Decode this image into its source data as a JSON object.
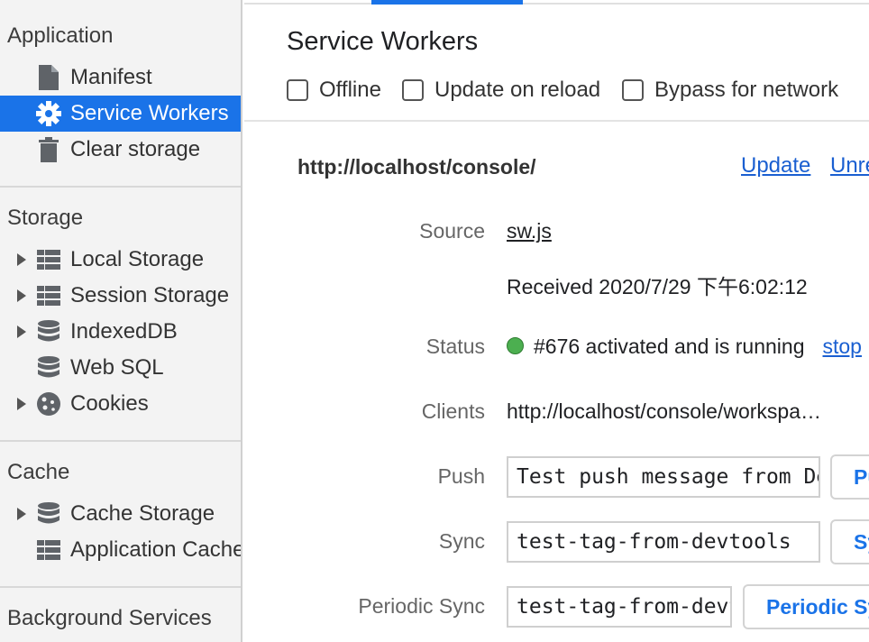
{
  "sidebar": {
    "sections": [
      {
        "title": "Application",
        "items": [
          {
            "label": "Manifest",
            "icon": "file-icon"
          },
          {
            "label": "Service Workers",
            "icon": "gear-icon",
            "selected": true
          },
          {
            "label": "Clear storage",
            "icon": "trash-icon"
          }
        ]
      },
      {
        "title": "Storage",
        "items": [
          {
            "label": "Local Storage",
            "icon": "grid-icon",
            "expandable": true
          },
          {
            "label": "Session Storage",
            "icon": "grid-icon",
            "expandable": true
          },
          {
            "label": "IndexedDB",
            "icon": "database-icon",
            "expandable": true
          },
          {
            "label": "Web SQL",
            "icon": "database-icon"
          },
          {
            "label": "Cookies",
            "icon": "cookie-icon",
            "expandable": true
          }
        ]
      },
      {
        "title": "Cache",
        "items": [
          {
            "label": "Cache Storage",
            "icon": "database-icon",
            "expandable": true
          },
          {
            "label": "Application Cache",
            "icon": "grid-icon"
          }
        ]
      },
      {
        "title": "Background Services",
        "items": []
      }
    ]
  },
  "main": {
    "title": "Service Workers",
    "options": [
      {
        "label": "Offline",
        "checked": false
      },
      {
        "label": "Update on reload",
        "checked": false
      },
      {
        "label": "Bypass for network",
        "checked": false
      }
    ],
    "scope": "http://localhost/console/",
    "update_link": "Update",
    "unregister_link": "Unregister",
    "rows": {
      "source_label": "Source",
      "source_value": "sw.js",
      "received": "Received 2020/7/29 下午6:02:12",
      "status_label": "Status",
      "status_value": "#676 activated and is running",
      "stop_link": "stop",
      "clients_label": "Clients",
      "clients_value": "http://localhost/console/workspa…",
      "push_label": "Push",
      "push_value": "Test push message from DevTools.",
      "push_button": "Push",
      "sync_label": "Sync",
      "sync_value": "test-tag-from-devtools",
      "sync_button": "Sync",
      "periodic_label": "Periodic Sync",
      "periodic_value": "test-tag-from-devtools",
      "periodic_button": "Periodic Sync"
    },
    "colors": {
      "accent": "#1a73e8",
      "status_running": "#4caf50",
      "link": "#1a5fd1"
    }
  }
}
